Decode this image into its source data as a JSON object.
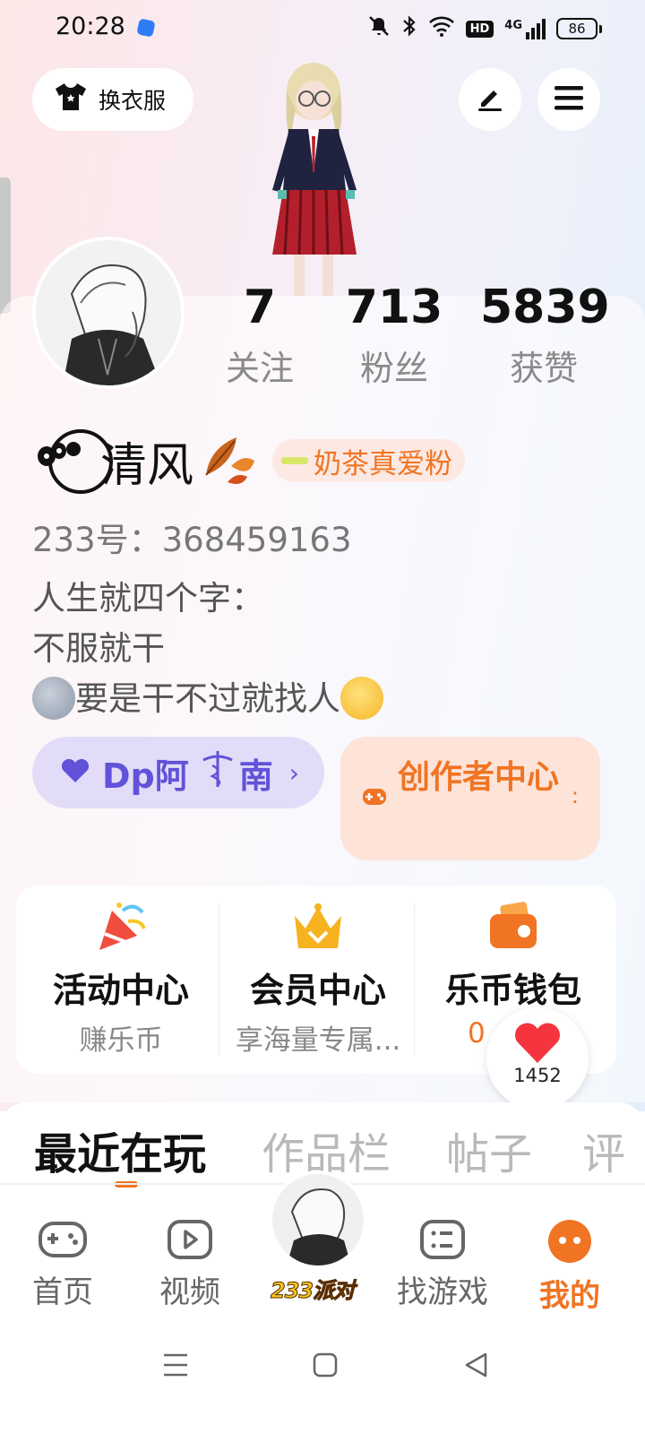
{
  "status_bar": {
    "time": "20:28",
    "battery": "86",
    "network": "4G",
    "hd_label": "HD"
  },
  "header": {
    "dress_button_label": "换衣服",
    "edit_icon": "pen-icon",
    "menu_icon": "hamburger-icon"
  },
  "stats": [
    {
      "value": "7",
      "label": "关注"
    },
    {
      "value": "713",
      "label": "粉丝"
    },
    {
      "value": "5839",
      "label": "获赞"
    }
  ],
  "profile": {
    "name": "清风",
    "fan_badge": "奶茶真爱粉",
    "uid": "233号：368459163",
    "bio_line1": "人生就四个字：",
    "bio_line2": "不服就干",
    "bio_line3": "要是干不过就找人"
  },
  "actions": {
    "dp_label": "Dp阿",
    "dp_label_tail": "南",
    "creator_label": "创作者中心"
  },
  "features": [
    {
      "title": "活动中心",
      "sub": "赚乐币"
    },
    {
      "title": "会员中心",
      "sub": "享海量专属..."
    },
    {
      "title": "乐币钱包",
      "sub": "0"
    }
  ],
  "heart_count": "1452",
  "tabs": [
    "最近在玩",
    "作品栏",
    "帖子",
    "评"
  ],
  "bottom_nav": [
    {
      "label": "首页"
    },
    {
      "label": "视频"
    },
    {
      "label": "找游戏"
    },
    {
      "label": "我的"
    }
  ],
  "center_label": "233派对",
  "colors": {
    "accent": "#f07423",
    "dp_purple": "#6152d8"
  }
}
